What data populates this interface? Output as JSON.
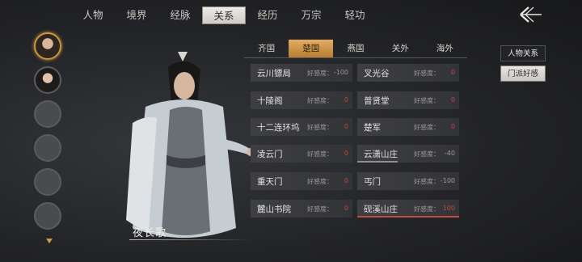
{
  "nav": {
    "tabs": [
      {
        "label": "人物"
      },
      {
        "label": "境界"
      },
      {
        "label": "经脉"
      },
      {
        "label": "关系",
        "active": true
      },
      {
        "label": "经历"
      },
      {
        "label": "万宗"
      },
      {
        "label": "轻功"
      }
    ],
    "back_icon": "back-arrow-icon"
  },
  "character": {
    "name": "夜长歌"
  },
  "regions": [
    {
      "label": "齐国"
    },
    {
      "label": "楚国",
      "active": true
    },
    {
      "label": "燕国"
    },
    {
      "label": "关外"
    },
    {
      "label": "海外"
    }
  ],
  "favor_label": "好感度：",
  "factions": [
    {
      "name": "云川镖局",
      "value": "-100",
      "bar_fraction": 0,
      "bar_color": "gray"
    },
    {
      "name": "叉光谷",
      "value": "0",
      "bar_fraction": 0,
      "bar_color": "gray"
    },
    {
      "name": "十陵阁",
      "value": "0",
      "bar_fraction": 0,
      "bar_color": "gray"
    },
    {
      "name": "普贤堂",
      "value": "0",
      "bar_fraction": 0,
      "bar_color": "gray"
    },
    {
      "name": "十二连环坞",
      "value": "0",
      "bar_fraction": 0,
      "bar_color": "gray"
    },
    {
      "name": "楚军",
      "value": "0",
      "bar_fraction": 0,
      "bar_color": "gray"
    },
    {
      "name": "凌云门",
      "value": "0",
      "bar_fraction": 0,
      "bar_color": "gray"
    },
    {
      "name": "云潇山庄",
      "value": "-40",
      "bar_fraction": 0.4,
      "bar_color": "gray"
    },
    {
      "name": "重天门",
      "value": "0",
      "bar_fraction": 0,
      "bar_color": "gray"
    },
    {
      "name": "丐门",
      "value": "-100",
      "bar_fraction": 0,
      "bar_color": "gray"
    },
    {
      "name": "麓山书院",
      "value": "0",
      "bar_fraction": 0,
      "bar_color": "gray"
    },
    {
      "name": "砚溪山庄",
      "value": "100",
      "bar_fraction": 1,
      "bar_color": "red"
    }
  ],
  "side_buttons": [
    {
      "label": "人物关系"
    },
    {
      "label": "门派好感",
      "active": true
    }
  ],
  "avatars": [
    "avatar-male",
    "avatar-female",
    "empty",
    "empty",
    "empty",
    "empty"
  ],
  "colors": {
    "accent": "#d39a4a",
    "favor_red": "#c54a40"
  }
}
